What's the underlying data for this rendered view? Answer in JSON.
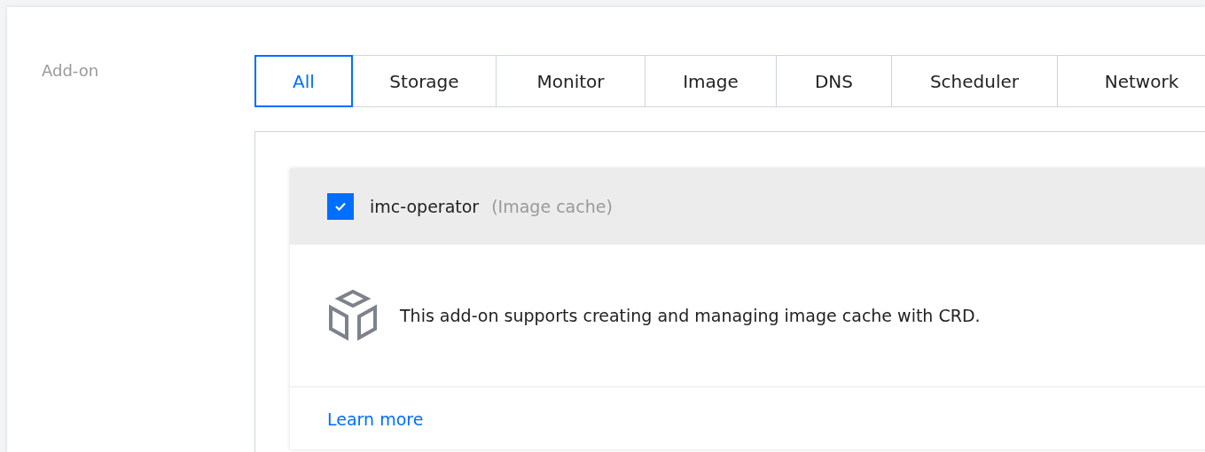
{
  "field_label": "Add-on",
  "tabs": [
    {
      "label": "All",
      "selected": true
    },
    {
      "label": "Storage",
      "selected": false
    },
    {
      "label": "Monitor",
      "selected": false
    },
    {
      "label": "Image",
      "selected": false
    },
    {
      "label": "DNS",
      "selected": false
    },
    {
      "label": "Scheduler",
      "selected": false
    },
    {
      "label": "Network",
      "selected": false
    }
  ],
  "addons": [
    {
      "name": "imc-operator",
      "category": "(Image cache)",
      "checked": true,
      "description": "This add-on supports creating and managing image cache with CRD.",
      "link": "Learn more"
    }
  ]
}
